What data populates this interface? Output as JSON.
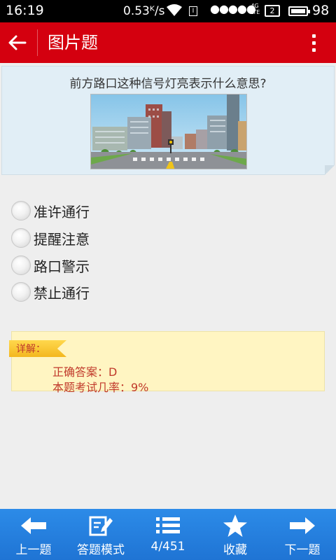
{
  "status_bar": {
    "time": "16:19",
    "network_speed": "0.53ᴷ/s",
    "sim_label": "Ⅰ",
    "signal_dots": "●●●●●",
    "network_type": "4G LTE",
    "sim_slot": "2",
    "battery_percent": "98"
  },
  "header": {
    "title": "图片题"
  },
  "question": {
    "text": "前方路口这种信号灯亮表示什么意思?"
  },
  "options": [
    {
      "label": "准许通行"
    },
    {
      "label": "提醒注意"
    },
    {
      "label": "路口警示"
    },
    {
      "label": "禁止通行"
    }
  ],
  "explanation": {
    "tag": "详解：",
    "answer_line": "正确答案：D",
    "rate_line": "本题考试几率：9%"
  },
  "toolbar": {
    "prev_label": "上一题",
    "mode_label": "答题模式",
    "progress_label": "4/451",
    "favorite_label": "收藏",
    "next_label": "下一题"
  },
  "colors": {
    "header_red": "#d4000f",
    "toolbar_blue": "#1f74d4",
    "question_bg": "#e1eef6",
    "explain_bg": "#fff5c2",
    "explain_text": "#c0392b"
  },
  "icons": {
    "back": "arrow-left-icon",
    "more": "overflow-menu-icon",
    "prev": "arrow-left-icon",
    "mode": "edit-note-icon",
    "list": "list-icon",
    "favorite": "star-icon",
    "next": "arrow-right-icon"
  }
}
